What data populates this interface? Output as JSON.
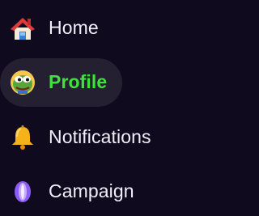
{
  "sidebar": {
    "items": [
      {
        "label": "Home",
        "icon": "house-icon",
        "active": false
      },
      {
        "label": "Profile",
        "icon": "pepe-avatar-icon",
        "active": true
      },
      {
        "label": "Notifications",
        "icon": "bell-icon",
        "active": false
      },
      {
        "label": "Campaign",
        "icon": "crystal-icon",
        "active": false
      }
    ]
  },
  "colors": {
    "background": "#100a1f",
    "active_pill": "#242032",
    "active_text": "#3fe23b",
    "text": "#f2eef8"
  }
}
